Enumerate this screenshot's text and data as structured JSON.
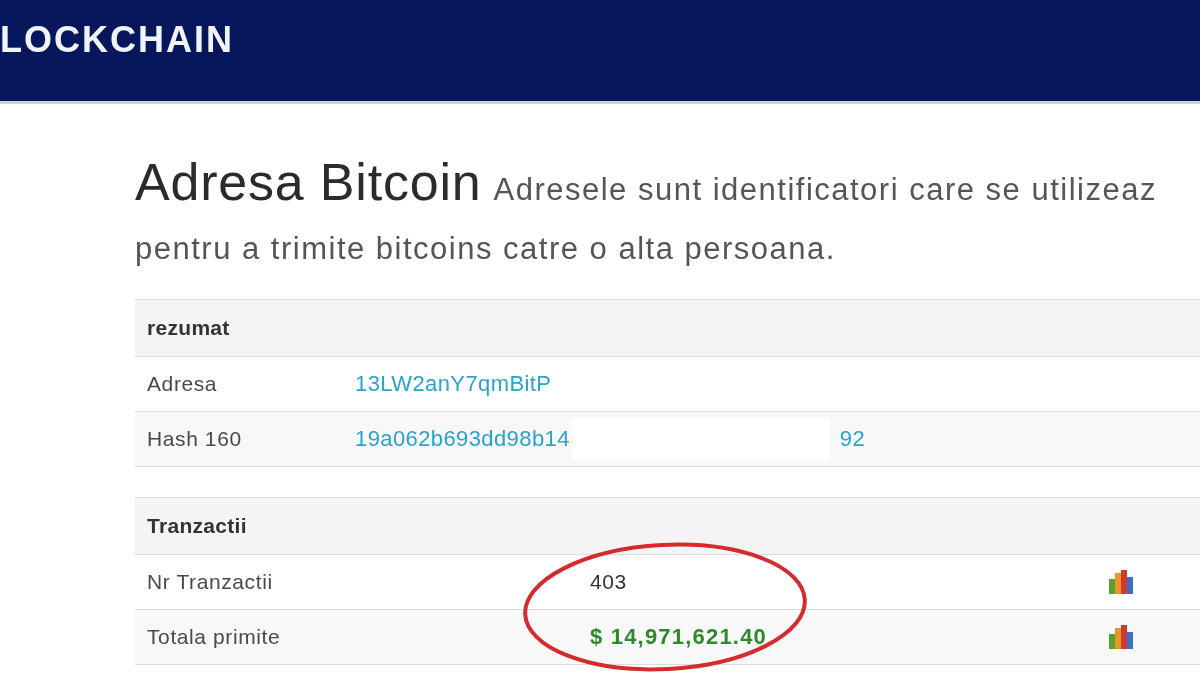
{
  "header": {
    "logo": "LOCKCHAIN"
  },
  "page": {
    "title": "Adresa Bitcoin",
    "description_lines": [
      "Adresele sunt identificatori care se utilizeaz",
      "pentru a trimite bitcoins catre o alta persoana."
    ]
  },
  "tables": [
    {
      "kind": "summary",
      "heading": "rezumat",
      "rows": [
        {
          "label": "Adresa",
          "kind": "link",
          "value": "13LW2anY7qmBitP"
        },
        {
          "label": "Hash 160",
          "kind": "redacted_link",
          "value_parts": [
            "19a062b693dd98b14",
            "92"
          ]
        }
      ]
    },
    {
      "kind": "transactions",
      "heading": "Tranzactii",
      "rows": [
        {
          "label": "Nr Tranzactii",
          "kind": "count",
          "value": "403"
        },
        {
          "label": "Totala primite",
          "kind": "amount",
          "value": "$ 14,971,621.40"
        }
      ]
    }
  ]
}
